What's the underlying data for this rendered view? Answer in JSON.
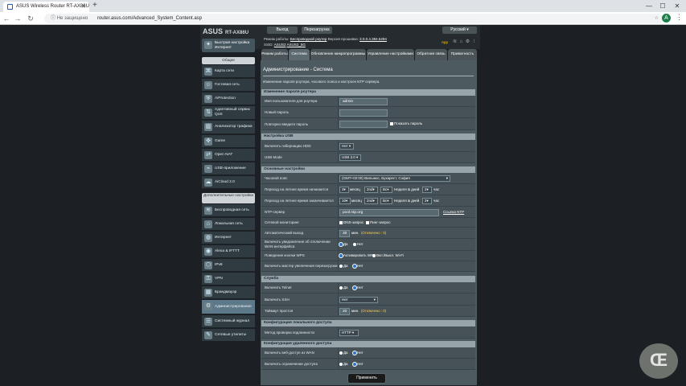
{
  "browser": {
    "tab_title": "ASUS Wireless Router RT-AX86U",
    "security": "Не защищено",
    "url": "router.asus.com/Advanced_System_Content.asp",
    "avatar": "A"
  },
  "header": {
    "logo": "ASUS",
    "model": "RT-AX86U",
    "logout": "Выход",
    "reboot": "Перезагрузка",
    "language": "Русский",
    "op_mode_label": "Режим работы:",
    "op_mode_value": "Беспроводной роутер",
    "fw_label": "Версия прошивки:",
    "fw_value": "3.0.0.4.384.5294",
    "ssid_label": "SSID:",
    "ssid_1": "ASUS2",
    "ssid_2": "ASUS2_5G",
    "app_label": "App"
  },
  "sidebar": {
    "quick": "Быстрая настройка Интернет",
    "general": "Общие",
    "items": [
      "Карта сети",
      "Гостевая сеть",
      "AiProtection",
      "Адаптивный сервис QoS",
      "Анализатор трафика",
      "Game",
      "Open NAT",
      "USB-приложение",
      "AiCloud 2.0"
    ],
    "advanced": "Дополнительные настройки",
    "adv_items": [
      "Беспроводная сеть",
      "Локальная сеть",
      "Интернет",
      "Alexa & IFTTT",
      "IPv6",
      "VPN",
      "Брандмауэр",
      "Администрирование",
      "Системный журнал",
      "Сетевые утилиты"
    ]
  },
  "tabs": [
    "Режим работы",
    "Система",
    "Обновление микропрограммы",
    "Управление настройками",
    "Обратная связь",
    "Приватность"
  ],
  "page": {
    "title": "Администрирование - Система",
    "desc": "Изменение пароля роутера, часового пояса и настроек NTP сервера.",
    "apply": "Применить"
  },
  "sec_login": {
    "head": "Изменение пароля роутера",
    "name_label": "Имя пользователя для роутера",
    "name_value": "admin",
    "newpass_label": "Новый пароль",
    "repeat_label": "Повторно введите пароль",
    "show_label": "Показать пароль"
  },
  "sec_usb": {
    "head": "Настройка USB",
    "hdd_label": "Включить гибернацию HDD",
    "hdd_value": "Нет",
    "mode_label": "USB Mode",
    "mode_value": "USB 3.0"
  },
  "sec_basic": {
    "head": "Основные настройки",
    "tz_label": "Часовой пояс",
    "tz_value": "(GMT+02:00) Вильнюс, Бухарест, София",
    "dst_start_label": "Переход на летнее время начинается",
    "dst_start": [
      "3",
      "2nd",
      "Вс"
    ],
    "dst_start_hour": "2",
    "dst_end_label": "Переход на летнее время заканчивается",
    "dst_end": [
      "10",
      "2nd",
      "Вс"
    ],
    "dst_end_hour": "2",
    "month": "месяц",
    "weekday": "Неделя & дней",
    "hour": "час",
    "ntp_label": "NTP-сервер",
    "ntp_value": "pool.ntp.org",
    "ntp_link": "Ссылка NTP",
    "mon_label": "Сетевой мониторинг",
    "dns": "DNS-запрос",
    "ping": "Пинг-запрос",
    "logout_label": "Автоматический выход",
    "logout_value": "30",
    "logout_unit": "мин.",
    "logout_note": "(Отключено : 0)",
    "wan_label": "Включить уведомление об отключении WAN-интерфейса",
    "yes": "Да",
    "no": "Нет",
    "wps_label": "Поведение кнопки WPS",
    "wps_opt1": "Активировать WPS",
    "wps_opt2": "Вкл./Выкл. Wi-Fi",
    "reboot_label": "Включить мастер увеличения перезагрузки"
  },
  "sec_service": {
    "head": "Служба",
    "telnet_label": "Включить Telnet",
    "ssh_label": "Включить SSH",
    "ssh_value": "Нет",
    "idle_label": "Таймаут простоя",
    "idle_value": "20",
    "idle_unit": "мин.",
    "idle_note": "(Отключено : 0)"
  },
  "sec_local": {
    "head": "Конфигурация локального доступа",
    "auth_label": "Метод проверки подлинности",
    "auth_value": "HTTP"
  },
  "sec_remote": {
    "head": "Конфигурация удаленного доступа",
    "wan_label": "Включить веб-доступ из WAN",
    "limit_label": "Включить ограничение доступа"
  },
  "watermark": "Œ"
}
